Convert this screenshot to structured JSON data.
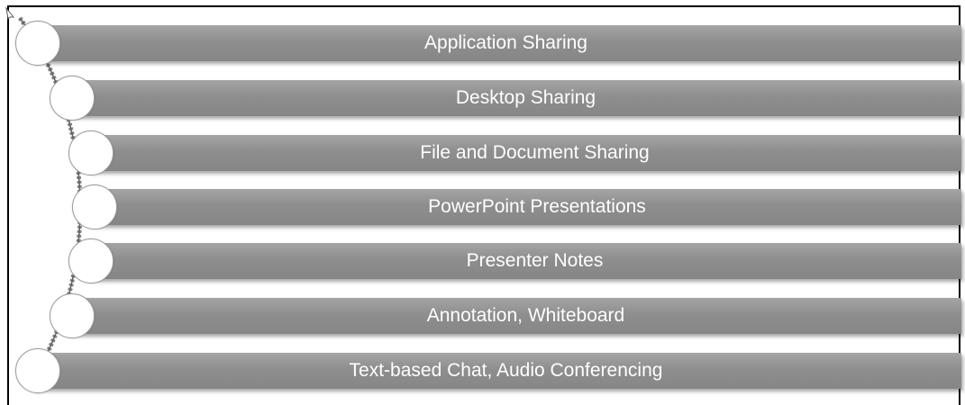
{
  "diagram": {
    "items": [
      {
        "label": "Application Sharing"
      },
      {
        "label": "Desktop Sharing"
      },
      {
        "label": "File and Document Sharing"
      },
      {
        "label": "PowerPoint Presentations"
      },
      {
        "label": "Presenter Notes"
      },
      {
        "label": "Annotation, Whiteboard"
      },
      {
        "label": "Text-based Chat, Audio Conferencing"
      }
    ]
  }
}
